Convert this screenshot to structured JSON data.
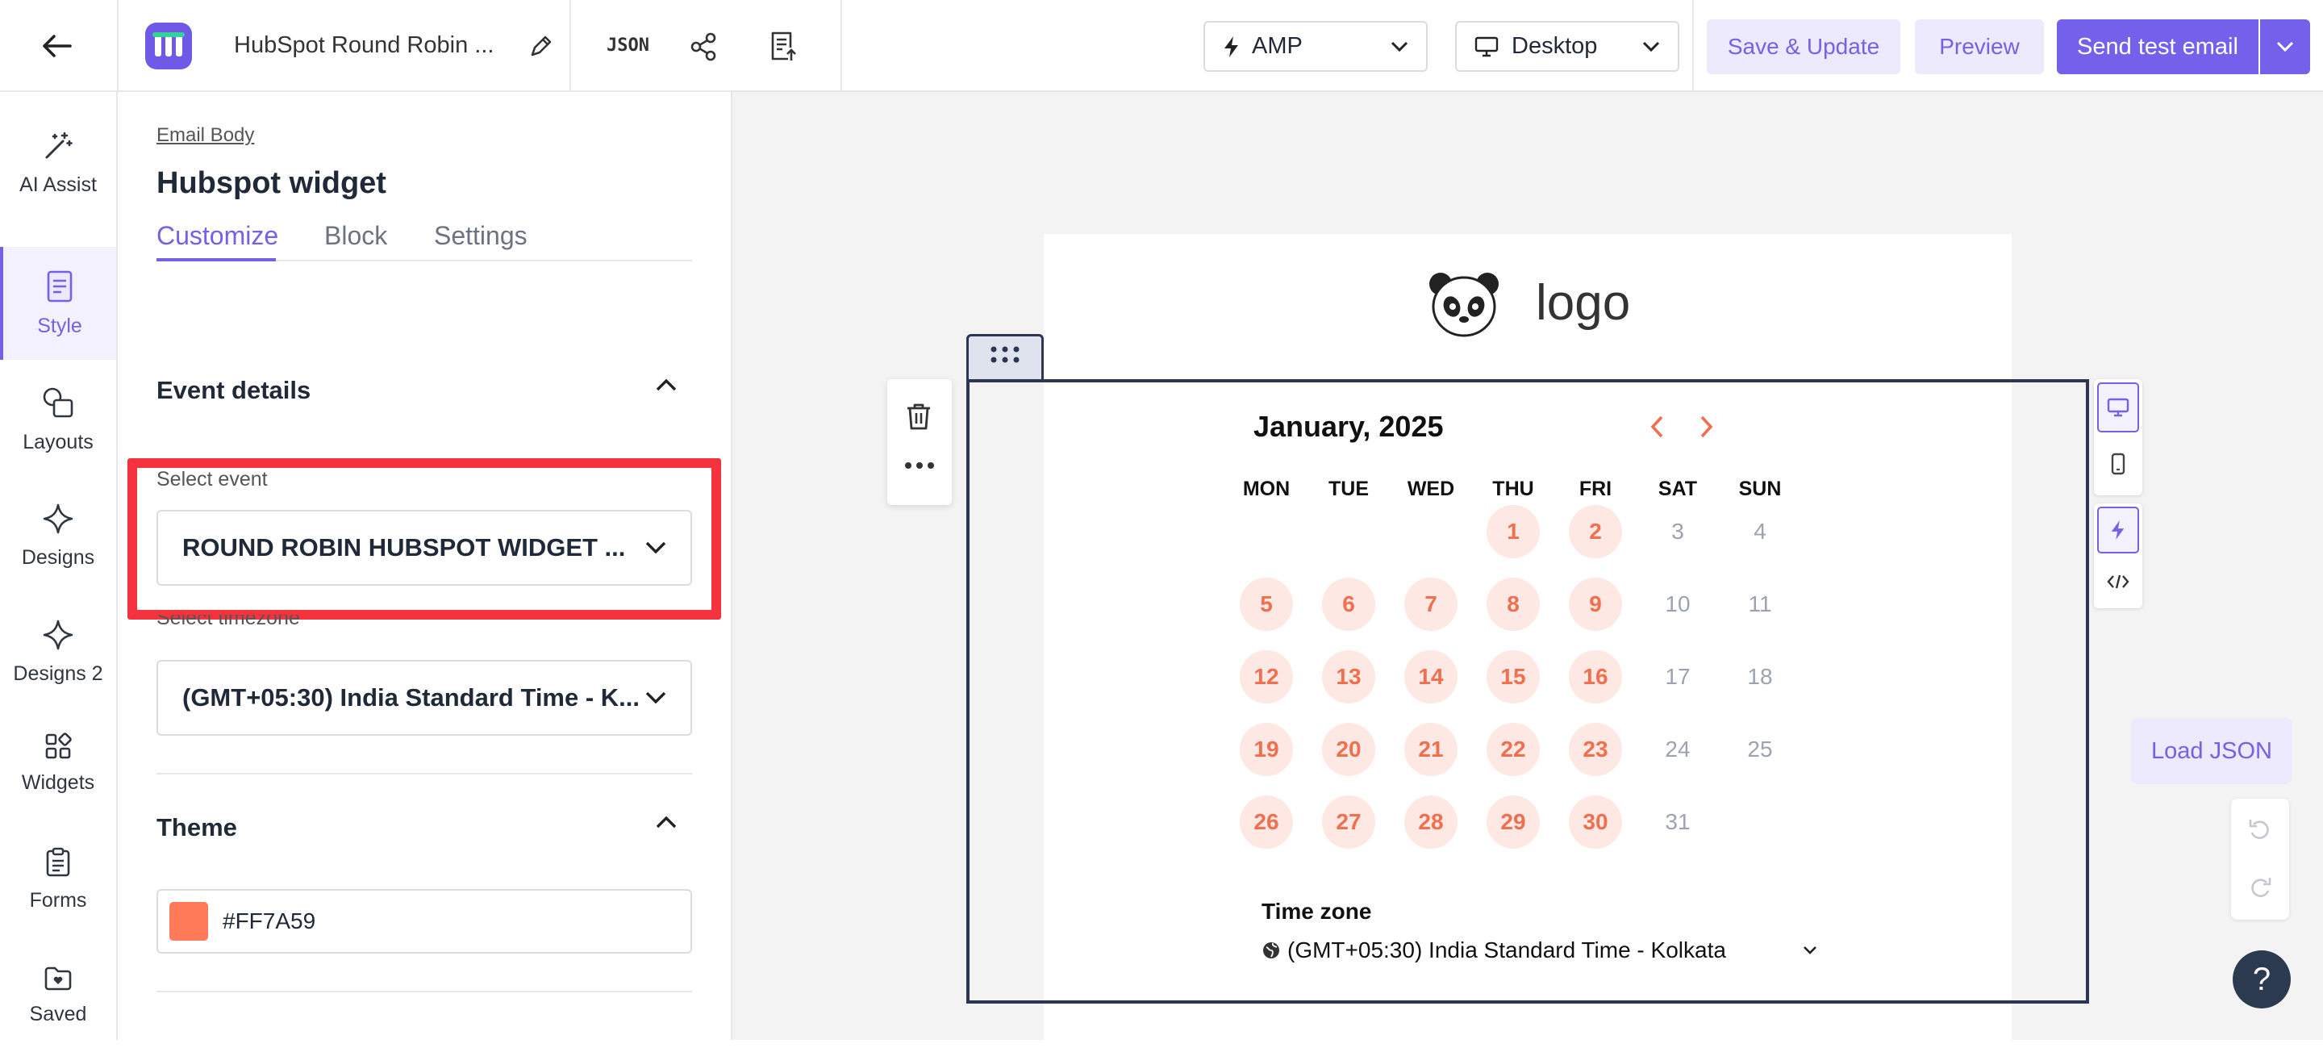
{
  "header": {
    "title": "HubSpot Round Robin ...",
    "json_label": "JSON",
    "format": "AMP",
    "device": "Desktop",
    "save_label": "Save & Update",
    "preview_label": "Preview",
    "send_label": "Send test email"
  },
  "rail": {
    "items": [
      {
        "label": "AI Assist",
        "icon": "magic-wand-icon"
      },
      {
        "label": "Style",
        "icon": "style-icon",
        "active": true
      },
      {
        "label": "Layouts",
        "icon": "layouts-icon"
      },
      {
        "label": "Designs",
        "icon": "sparkle-icon"
      },
      {
        "label": "Designs 2",
        "icon": "sparkle-icon"
      },
      {
        "label": "Widgets",
        "icon": "widgets-icon"
      },
      {
        "label": "Forms",
        "icon": "clipboard-icon"
      },
      {
        "label": "Saved",
        "icon": "folder-heart-icon"
      }
    ]
  },
  "panel": {
    "breadcrumb": "Email Body",
    "title": "Hubspot widget",
    "tabs": [
      "Customize",
      "Block",
      "Settings"
    ],
    "active_tab": "Customize",
    "event_section": "Event details",
    "select_event_label": "Select event",
    "select_event_value": "ROUND ROBIN HUBSPOT WIDGET ...",
    "select_timezone_label": "Select timezone",
    "select_timezone_value": "(GMT+05:30) India Standard Time - K...",
    "theme_section": "Theme",
    "theme_color": "#FF7A59"
  },
  "canvas": {
    "logo_text": "logo",
    "calendar": {
      "month": "January, 2025",
      "weekdays": [
        "MON",
        "TUE",
        "WED",
        "THU",
        "FRI",
        "SAT",
        "SUN"
      ],
      "weeks": [
        [
          null,
          null,
          null,
          "1",
          "2",
          "3",
          "4"
        ],
        [
          "5",
          "6",
          "7",
          "8",
          "9",
          "10",
          "11"
        ],
        [
          "12",
          "13",
          "14",
          "15",
          "16",
          "17",
          "18"
        ],
        [
          "19",
          "20",
          "21",
          "22",
          "23",
          "24",
          "25"
        ],
        [
          "26",
          "27",
          "28",
          "29",
          "30",
          "31",
          null
        ]
      ],
      "available": [
        "1",
        "2",
        "5",
        "6",
        "7",
        "8",
        "9",
        "12",
        "13",
        "14",
        "15",
        "16",
        "19",
        "20",
        "21",
        "22",
        "23",
        "26",
        "27",
        "28",
        "29",
        "30"
      ],
      "timezone_title": "Time zone",
      "timezone_value": "(GMT+05:30) India Standard Time - Kolkata"
    },
    "load_json_label": "Load JSON",
    "help_label": "?"
  },
  "colors": {
    "accent": "#7361EC",
    "highlight": "#F5333F",
    "calendar_accent": "#EF6F4F"
  }
}
